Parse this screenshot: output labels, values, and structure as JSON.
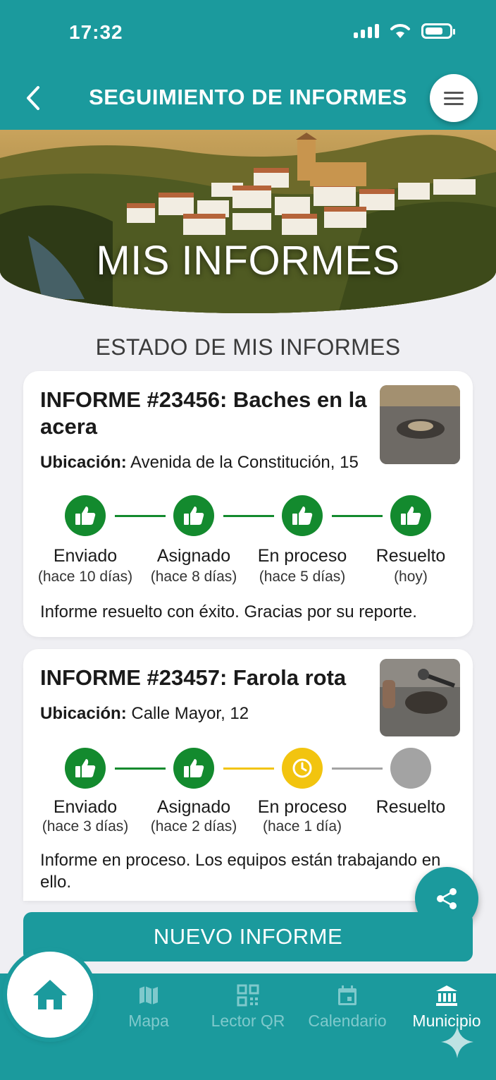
{
  "status_bar": {
    "time": "17:32"
  },
  "header": {
    "title": "SEGUIMIENTO DE INFORMES"
  },
  "hero": {
    "title": "MIS INFORMES"
  },
  "section": {
    "title": "ESTADO DE MIS INFORMES"
  },
  "reports": [
    {
      "title": "INFORME #23456: Baches en la acera",
      "location_label": "Ubicación:",
      "location": "Avenida de la Constitución, 15",
      "steps": [
        {
          "label": "Enviado",
          "sub": "(hace 10 días)",
          "status": "done"
        },
        {
          "label": "Asignado",
          "sub": "(hace 8 días)",
          "status": "done"
        },
        {
          "label": "En proceso",
          "sub": "(hace 5 días)",
          "status": "done"
        },
        {
          "label": "Resuelto",
          "sub": "(hoy)",
          "status": "done"
        }
      ],
      "message": "Informe resuelto con éxito. Gracias por su reporte."
    },
    {
      "title": "INFORME #23457: Farola rota",
      "location_label": "Ubicación:",
      "location": "Calle Mayor, 12",
      "steps": [
        {
          "label": "Enviado",
          "sub": "(hace 3 días)",
          "status": "done"
        },
        {
          "label": "Asignado",
          "sub": "(hace 2 días)",
          "status": "done"
        },
        {
          "label": "En proceso",
          "sub": "(hace 1 día)",
          "status": "in-progress"
        },
        {
          "label": "Resuelto",
          "sub": "",
          "status": "pending"
        }
      ],
      "message": "Informe en proceso. Los equipos están trabajando en ello."
    }
  ],
  "actions": {
    "new_report": "NUEVO INFORME"
  },
  "nav": {
    "items": [
      {
        "label": "Mapa",
        "icon": "map-icon"
      },
      {
        "label": "Lector QR",
        "icon": "qr-icon"
      },
      {
        "label": "Calendario",
        "icon": "calendar-icon"
      },
      {
        "label": "Municipio",
        "icon": "municipality-icon"
      }
    ]
  },
  "colors": {
    "primary": "#1b9a9d",
    "done": "#138a2e",
    "in_progress": "#f2c40f",
    "pending": "#a3a3a3"
  }
}
